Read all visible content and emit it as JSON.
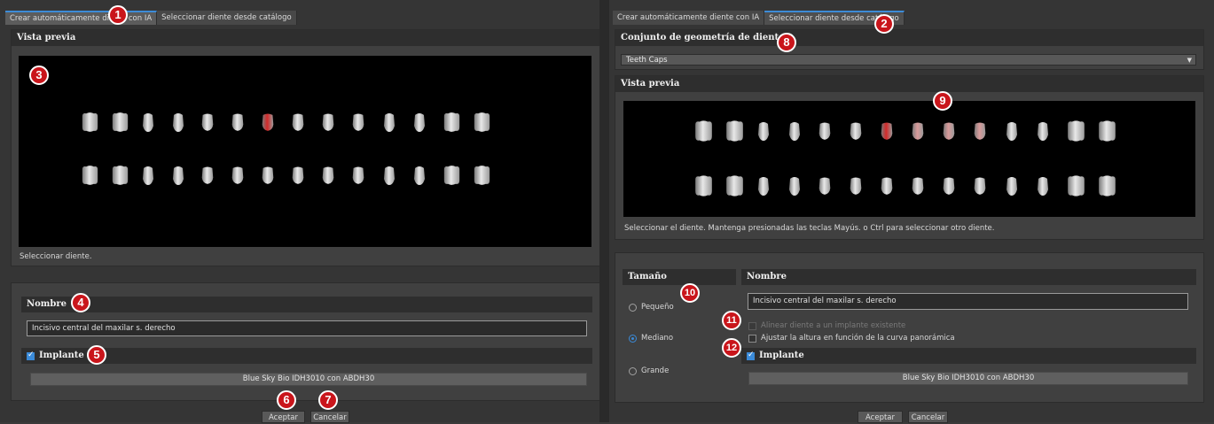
{
  "left": {
    "tabs": [
      "Crear automáticamente diente con IA",
      "Seleccionar diente desde catálogo"
    ],
    "preview_header": "Vista previa",
    "preview_caption": "Seleccionar diente.",
    "name_header": "Nombre",
    "name_value": "Incisivo central del maxilar s. derecho",
    "implant_label": "Implante",
    "implant_button": "Blue Sky Bio IDH3010 con ABDH30",
    "accept": "Aceptar",
    "cancel": "Cancelar"
  },
  "right": {
    "tabs": [
      "Crear automáticamente diente con IA",
      "Seleccionar diente desde catálogo"
    ],
    "geometry_header": "Conjunto de geometría de dientes",
    "geometry_value": "Teeth Caps",
    "preview_header": "Vista previa",
    "preview_caption": "Seleccionar el diente. Mantenga presionadas las teclas Mayús. o Ctrl para seleccionar otro diente.",
    "size_header": "Tamaño",
    "sizes": [
      "Pequeño",
      "Mediano",
      "Grande"
    ],
    "name_header": "Nombre",
    "name_value": "Incisivo central del maxilar s. derecho",
    "align_label": "Alinear diente a un implante existente",
    "adjust_label": "Ajustar la altura en función de la curva panorámica",
    "implant_label": "Implante",
    "implant_button": "Blue Sky Bio IDH3010 con ABDH30",
    "accept": "Aceptar",
    "cancel": "Cancelar"
  },
  "badges": [
    "1",
    "2",
    "3",
    "4",
    "5",
    "6",
    "7",
    "8",
    "9",
    "10",
    "11",
    "12"
  ],
  "colors": {
    "accent": "#3a8ad8",
    "selected_tooth": "#d42a2a",
    "badge": "#c9151b",
    "pink_tooth": "#d99a9a"
  },
  "icons": {
    "checkbox": "check-icon",
    "dropdown": "chevron-down-icon"
  }
}
